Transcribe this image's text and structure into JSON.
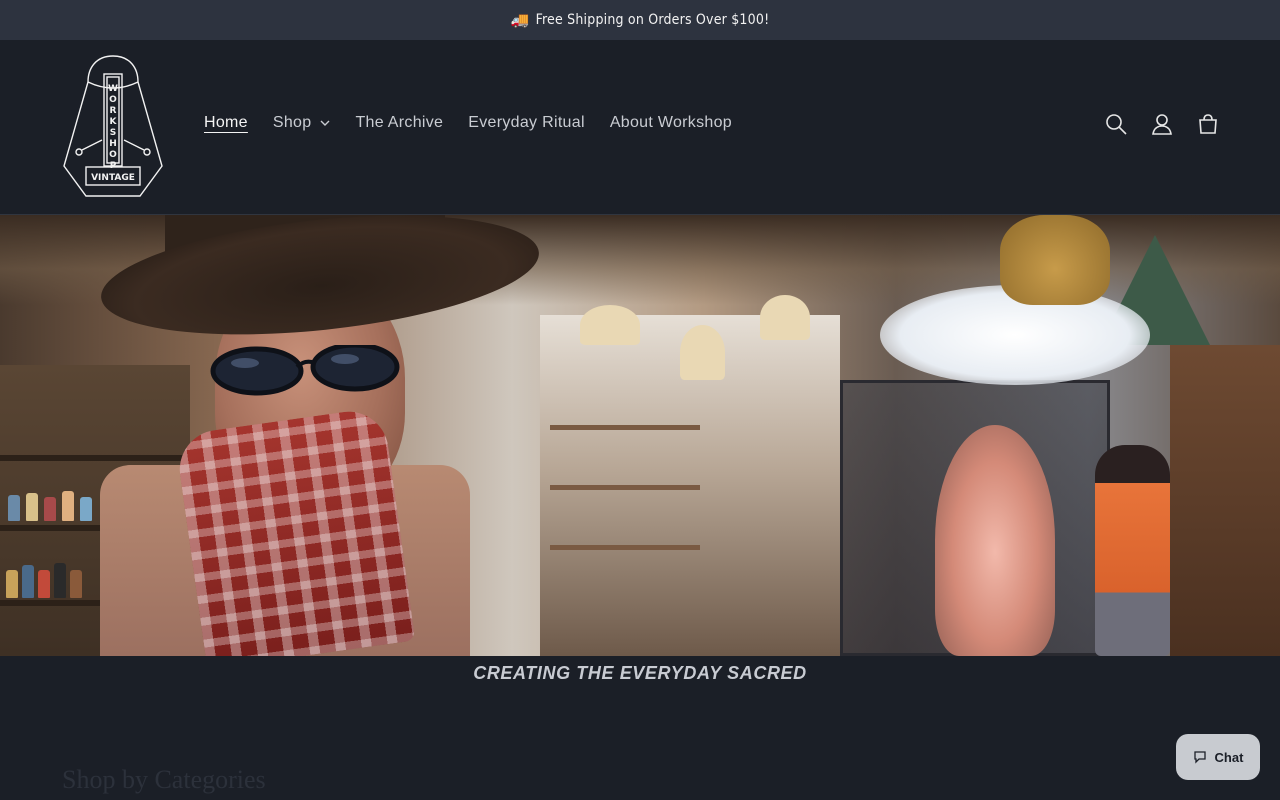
{
  "announcement": {
    "icon": "truck-icon",
    "text": "Free Shipping on Orders Over $100!"
  },
  "header": {
    "logo": {
      "letters": "WORKSHOP",
      "subtext": "VINTAGE"
    },
    "nav": [
      {
        "label": "Home",
        "active": true
      },
      {
        "label": "Shop",
        "has_dropdown": true
      },
      {
        "label": "The Archive"
      },
      {
        "label": "Everyday Ritual"
      },
      {
        "label": "About Workshop"
      }
    ],
    "icons": [
      "search-icon",
      "account-icon",
      "cart-icon"
    ]
  },
  "hero": {
    "tagline": "CREATING THE EVERYDAY SACRED"
  },
  "section": {
    "title": "Shop by Categories"
  },
  "chat": {
    "label": "Chat",
    "icon": "chat-bubble-icon"
  },
  "colors": {
    "page_bg": "#1b1f27",
    "announce_bg": "#2d333f",
    "chat_bg": "#c8cbd0"
  }
}
